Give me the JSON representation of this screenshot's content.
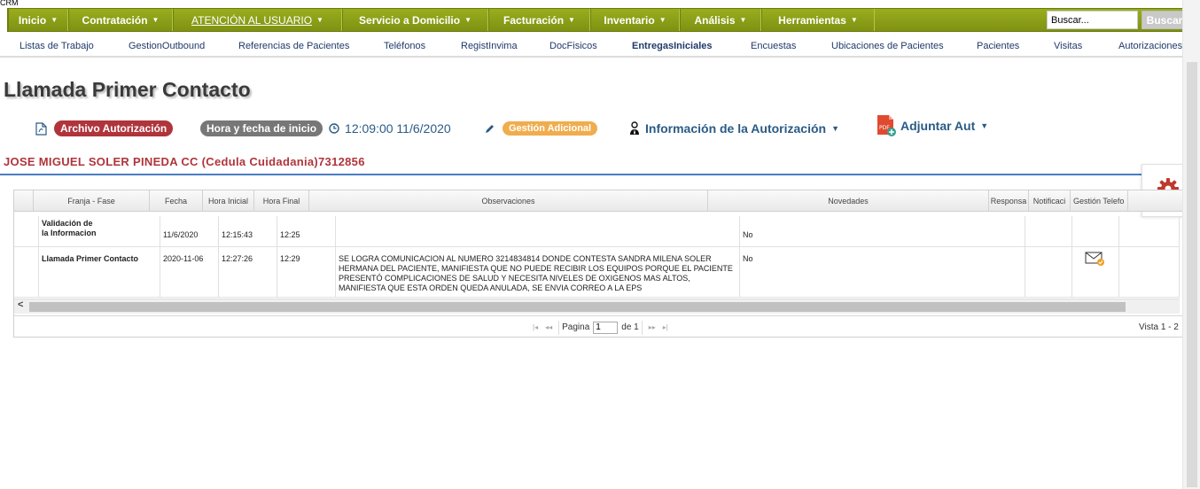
{
  "app": {
    "tag": "CRM"
  },
  "topnav": {
    "items": [
      {
        "label": "Inicio"
      },
      {
        "label": "Contratación"
      },
      {
        "label": "ATENCIÓN AL USUARIO"
      },
      {
        "label": "Servicio a Domicilio"
      },
      {
        "label": "Facturación"
      },
      {
        "label": "Inventario"
      },
      {
        "label": "Análisis"
      },
      {
        "label": "Herramientas"
      }
    ],
    "search_value": "Buscar...",
    "search_button": "Buscar",
    "brand_color": "#8a9c17"
  },
  "subnav": {
    "items": [
      {
        "label": "Listas de Trabajo"
      },
      {
        "label": "GestionOutbound"
      },
      {
        "label": "Referencias de Pacientes"
      },
      {
        "label": "Teléfonos"
      },
      {
        "label": "RegistInvima"
      },
      {
        "label": "DocFisicos"
      },
      {
        "label": "EntregasIniciales"
      },
      {
        "label": "Encuestas"
      },
      {
        "label": "Ubicaciones de Pacientes"
      },
      {
        "label": "Pacientes"
      },
      {
        "label": "Visitas"
      },
      {
        "label": "Autorizaciones"
      }
    ]
  },
  "page": {
    "title": "Llamada Primer Contacto",
    "patient": "JOSE MIGUEL SOLER PINEDA CC (Cedula Cuidadania)7312856"
  },
  "toolbar": {
    "archivo_label": "Archivo Autorización",
    "hora_label": "Hora y fecha de inicio",
    "hora_value": "12:09:00 11/6/2020",
    "gestion_label": "Gestión Adicional",
    "info_label": "Información de la Autorización",
    "adjuntar_label": "Adjuntar Aut",
    "colors": {
      "archivo": "#b0343c",
      "hora": "#777777",
      "gestion": "#f0ad4e",
      "link": "#2a5b86"
    }
  },
  "grid": {
    "headers": [
      "Franja - Fase",
      "Fecha",
      "Hora Inicial",
      "Hora Final",
      "Observaciones",
      "Novedades",
      "Responsa",
      "Notificaci",
      "Gestión Telefo"
    ],
    "rows": [
      {
        "fase": "Validación de\nla Informacion",
        "fecha": "11/6/2020",
        "hora_inicial": "12:15:43",
        "hora_final": "12:25",
        "observaciones": "",
        "novedades": "No"
      },
      {
        "fase": "Llamada Primer Contacto",
        "fecha": "2020-11-06",
        "hora_inicial": "12:27:26",
        "hora_final": "12:29",
        "observaciones": "SE LOGRA COMUNICACION AL NUMERO 3214834814 DONDE CONTESTA SANDRA MILENA SOLER HERMANA DEL PACIENTE, MANIFIESTA QUE NO PUEDE RECIBIR LOS EQUIPOS PORQUE EL PACIENTE PRESENTÓ COMPLICACIONES DE SALUD Y NECESITA NIVELES DE OXIGENOS MAS ALTOS, MANIFIESTA QUE ESTA ORDEN QUEDA ANULADA, SE ENVIA CORREO A LA EPS",
        "novedades": "No",
        "notificacion_icon": "mail-check-icon"
      }
    ],
    "pager": {
      "page_label": "Pagina",
      "page_value": "1",
      "of_label": "de 1",
      "vista": "Vista 1 - 2"
    }
  }
}
